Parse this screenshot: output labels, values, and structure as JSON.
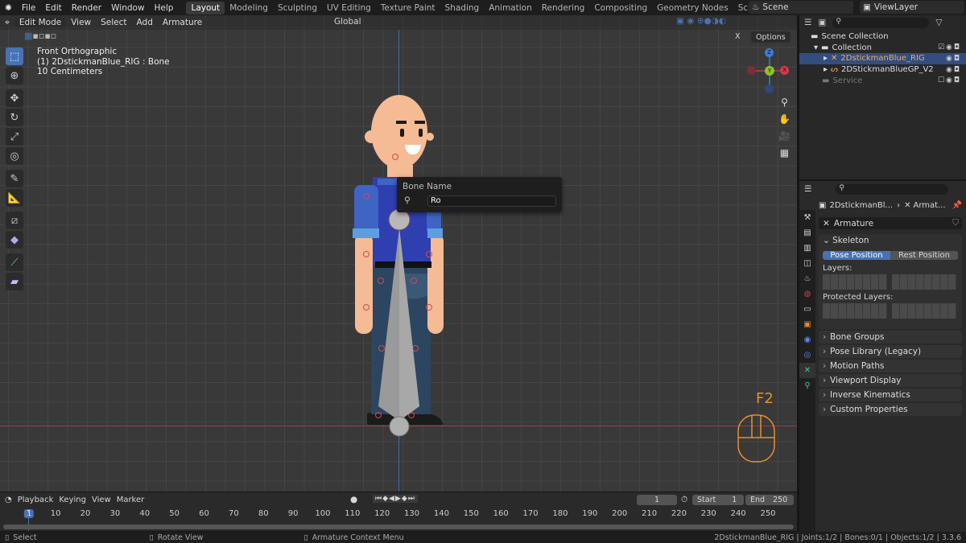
{
  "menu": [
    "File",
    "Edit",
    "Render",
    "Window",
    "Help"
  ],
  "workspaces": [
    "Layout",
    "Modeling",
    "Sculpting",
    "UV Editing",
    "Texture Paint",
    "Shading",
    "Animation",
    "Rendering",
    "Compositing",
    "Geometry Nodes",
    "Scripting",
    "+"
  ],
  "scene": "Scene",
  "view_layer": "ViewLayer",
  "viewport": {
    "mode": "Edit Mode",
    "menus": [
      "View",
      "Select",
      "Add",
      "Armature"
    ],
    "orientation": "Global",
    "options": "Options",
    "overlay_x": "X",
    "info": [
      "Front Orthographic",
      "(1) 2DstickmanBlue_RIG : Bone",
      "10 Centimeters"
    ],
    "gizmo": {
      "z": "Z",
      "y": "Y",
      "x": "X"
    },
    "hotkey": "F2"
  },
  "popup": {
    "title": "Bone Name",
    "value": "Ro"
  },
  "outliner": {
    "root": "Scene Collection",
    "items": [
      {
        "label": "Collection",
        "depth": 1
      },
      {
        "label": "2DstickmanBlue_RIG",
        "depth": 2,
        "selected": true
      },
      {
        "label": "2DStickmanBlueGP_V2",
        "depth": 2
      },
      {
        "label": "Service",
        "depth": 1,
        "disabled": true
      }
    ]
  },
  "properties": {
    "breadcrumb_object": "2DstickmanBl...",
    "breadcrumb_data": "Armat...",
    "data_name": "Armature",
    "skeleton": "Skeleton",
    "pose_position": "Pose Position",
    "rest_position": "Rest Position",
    "layers": "Layers:",
    "protected_layers": "Protected Layers:",
    "panels": [
      "Bone Groups",
      "Pose Library (Legacy)",
      "Motion Paths",
      "Viewport Display",
      "Inverse Kinematics",
      "Custom Properties"
    ]
  },
  "timeline": {
    "menus": [
      "Playback",
      "Keying",
      "View",
      "Marker"
    ],
    "current_frame": "1",
    "start_label": "Start",
    "start": "1",
    "end_label": "End",
    "end": "250",
    "ticks": [
      "1",
      "10",
      "20",
      "30",
      "40",
      "50",
      "60",
      "70",
      "80",
      "90",
      "100",
      "110",
      "120",
      "130",
      "140",
      "150",
      "160",
      "170",
      "180",
      "190",
      "200",
      "210",
      "220",
      "230",
      "240",
      "250"
    ]
  },
  "status": {
    "select": "Select",
    "rotate": "Rotate View",
    "context": "Armature Context Menu",
    "stats": "2DstickmanBlue_RIG | Joints:1/2 | Bones:0/1 | Objects:1/2 | 3.3.6"
  },
  "colors": {
    "accent": "#4772b3",
    "selected_text": "#f0a860",
    "hotkey": "#e8902a"
  }
}
